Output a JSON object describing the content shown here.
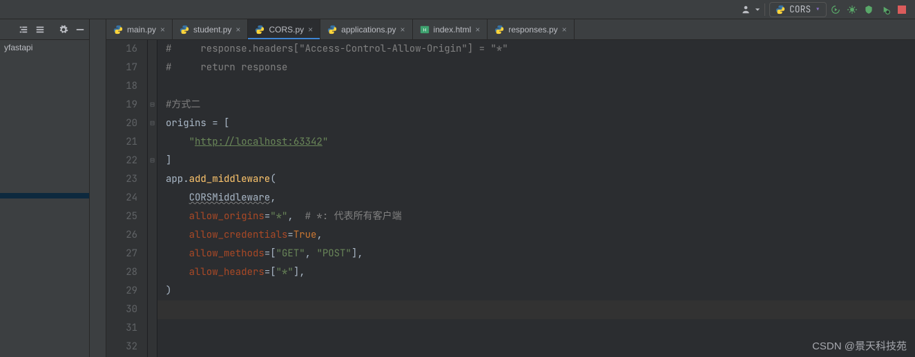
{
  "toolbar": {
    "run_config_label": "CORS",
    "icons": {
      "user": "user-icon",
      "run": "run-icon",
      "debug": "debug-icon",
      "coverage": "coverage-icon",
      "profile": "profile-icon",
      "stop": "stop-icon",
      "search": "search-icon",
      "hamburger": "hamburger-icon",
      "gear": "gear-icon",
      "collapse": "collapse-icon",
      "struct1": "structure-indent-icon",
      "struct2": "structure-flat-icon"
    }
  },
  "project": {
    "root_label": "yfastapi",
    "selected_item": ""
  },
  "tabs": [
    {
      "label": "main.py",
      "icon": "py",
      "active": false
    },
    {
      "label": "student.py",
      "icon": "py",
      "active": false
    },
    {
      "label": "CORS.py",
      "icon": "py",
      "active": true
    },
    {
      "label": "applications.py",
      "icon": "py",
      "active": false
    },
    {
      "label": "index.html",
      "icon": "html",
      "active": false
    },
    {
      "label": "responses.py",
      "icon": "py",
      "active": false
    }
  ],
  "editor": {
    "first_line_no": 16,
    "lines": [
      {
        "n": 16,
        "segments": [
          {
            "cls": "tok-comment",
            "t": "#     response.headers[\"Access-Control-Allow-Origin\"] = \"*\""
          }
        ]
      },
      {
        "n": 17,
        "segments": [
          {
            "cls": "tok-comment",
            "t": "#     return response"
          }
        ]
      },
      {
        "n": 18,
        "segments": []
      },
      {
        "n": 19,
        "fold": "⊟",
        "segments": [
          {
            "cls": "tok-comment",
            "t": "#方式二"
          }
        ]
      },
      {
        "n": 20,
        "fold": "⊟",
        "segments": [
          {
            "cls": "tok-ident",
            "t": "origins "
          },
          {
            "cls": "tok-op",
            "t": "= ["
          }
        ]
      },
      {
        "n": 21,
        "segments": [
          {
            "cls": "tok-op",
            "t": "    "
          },
          {
            "cls": "tok-string",
            "t": "\""
          },
          {
            "cls": "tok-link",
            "t": "http://localhost:63342"
          },
          {
            "cls": "tok-string",
            "t": "\""
          }
        ]
      },
      {
        "n": 22,
        "fold": "⊟",
        "segments": [
          {
            "cls": "tok-op",
            "t": "]"
          }
        ]
      },
      {
        "n": 23,
        "segments": [
          {
            "cls": "tok-ident",
            "t": "app"
          },
          {
            "cls": "tok-op",
            "t": "."
          },
          {
            "cls": "tok-func",
            "t": "add_middleware"
          },
          {
            "cls": "tok-op",
            "t": "("
          }
        ]
      },
      {
        "n": 24,
        "segments": [
          {
            "cls": "tok-op",
            "t": "    "
          },
          {
            "cls": "tok-class underline-wavy",
            "t": "CORSMiddleware"
          },
          {
            "cls": "tok-op",
            "t": ","
          }
        ]
      },
      {
        "n": 25,
        "segments": [
          {
            "cls": "tok-op",
            "t": "    "
          },
          {
            "cls": "tok-kwarg",
            "t": "allow_origins"
          },
          {
            "cls": "tok-op",
            "t": "="
          },
          {
            "cls": "tok-string",
            "t": "\"*\""
          },
          {
            "cls": "tok-op",
            "t": ",  "
          },
          {
            "cls": "tok-comment-zh",
            "t": "# *: 代表所有客户端"
          }
        ]
      },
      {
        "n": 26,
        "segments": [
          {
            "cls": "tok-op",
            "t": "    "
          },
          {
            "cls": "tok-kwarg",
            "t": "allow_credentials"
          },
          {
            "cls": "tok-op",
            "t": "="
          },
          {
            "cls": "tok-bool",
            "t": "True"
          },
          {
            "cls": "tok-op",
            "t": ","
          }
        ]
      },
      {
        "n": 27,
        "segments": [
          {
            "cls": "tok-op",
            "t": "    "
          },
          {
            "cls": "tok-kwarg",
            "t": "allow_methods"
          },
          {
            "cls": "tok-op",
            "t": "=["
          },
          {
            "cls": "tok-string",
            "t": "\"GET\""
          },
          {
            "cls": "tok-op",
            "t": ", "
          },
          {
            "cls": "tok-string",
            "t": "\"POST\""
          },
          {
            "cls": "tok-op",
            "t": "],"
          }
        ]
      },
      {
        "n": 28,
        "segments": [
          {
            "cls": "tok-op",
            "t": "    "
          },
          {
            "cls": "tok-kwarg",
            "t": "allow_headers"
          },
          {
            "cls": "tok-op",
            "t": "=["
          },
          {
            "cls": "tok-string",
            "t": "\"*\""
          },
          {
            "cls": "tok-op",
            "t": "],"
          }
        ]
      },
      {
        "n": 29,
        "segments": [
          {
            "cls": "tok-op",
            "t": ")"
          }
        ]
      },
      {
        "n": 30,
        "current": true,
        "segments": []
      },
      {
        "n": 31,
        "segments": []
      },
      {
        "n": 32,
        "segments": []
      }
    ]
  },
  "watermark": "CSDN @景天科技苑"
}
